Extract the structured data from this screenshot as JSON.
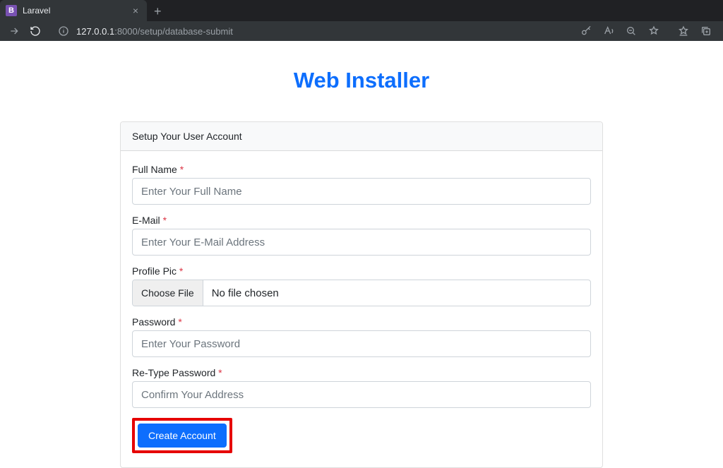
{
  "browser": {
    "tab": {
      "favicon_letter": "B",
      "title": "Laravel"
    },
    "url": {
      "host": "127.0.0.1",
      "rest": ":8000/setup/database-submit"
    }
  },
  "page": {
    "title": "Web Installer",
    "card_header": "Setup Your User Account",
    "full_name": {
      "label": "Full Name",
      "placeholder": "Enter Your Full Name"
    },
    "email": {
      "label": "E-Mail",
      "placeholder": "Enter Your E-Mail Address"
    },
    "profile_pic": {
      "label": "Profile Pic",
      "choose_button": "Choose File",
      "status": "No file chosen"
    },
    "password": {
      "label": "Password",
      "placeholder": "Enter Your Password"
    },
    "retype_password": {
      "label": "Re-Type Password",
      "placeholder": "Confirm Your Address"
    },
    "submit_label": "Create Account"
  }
}
